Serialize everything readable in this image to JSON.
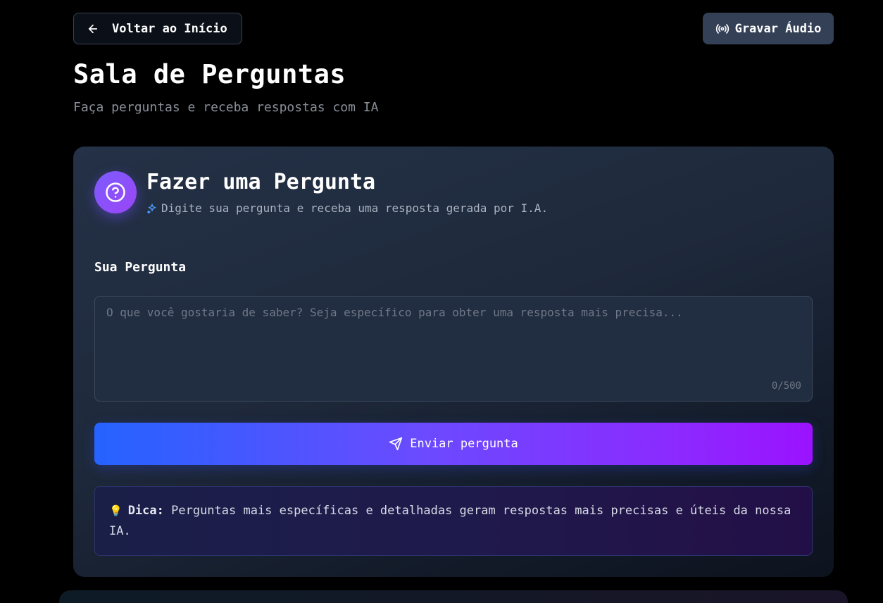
{
  "header": {
    "back_label": "Voltar ao Início",
    "record_label": "Gravar Áudio",
    "title": "Sala de Perguntas",
    "subtitle": "Faça perguntas e receba respostas com IA"
  },
  "card": {
    "title": "Fazer uma Pergunta",
    "description": "Digite sua pergunta e receba uma resposta gerada por I.A.",
    "field_label": "Sua Pergunta",
    "placeholder": "O que você gostaria de saber? Seja específico para obter uma resposta mais precisa...",
    "value": "",
    "counter": "0/500",
    "submit_label": "Enviar pergunta"
  },
  "tip": {
    "emoji": "💡",
    "label": "Dica:",
    "text": "Perguntas mais específicas e detalhadas geram respostas mais precisas e úteis da nossa IA."
  },
  "icons": {
    "back": "arrow-left-icon",
    "record": "radio-broadcast-icon",
    "card": "help-circle-icon",
    "description": "sparkles-icon",
    "submit": "send-icon",
    "tip": "lightbulb-icon"
  },
  "colors": {
    "background": "#000000",
    "card": "#1e293b",
    "record_button": "#344056",
    "gradient_start": "#2563ff",
    "gradient_end": "#9b12ff",
    "tip_border": "#2d3470"
  }
}
